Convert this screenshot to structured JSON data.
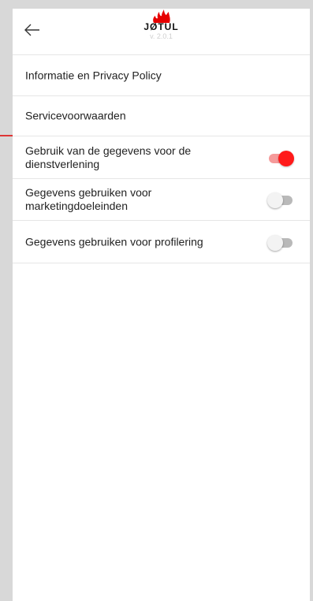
{
  "header": {
    "brand": "JØTUL",
    "version": "v. 2.0.1",
    "back_icon": "arrow-left-icon",
    "logo_icon": "flame-logo-icon"
  },
  "menu": {
    "items": [
      {
        "label": "Informatie en Privacy Policy"
      },
      {
        "label": "Servicevoorwaarden"
      }
    ]
  },
  "consents": [
    {
      "label": "Gebruik van de gegevens voor de dienstverlening",
      "enabled": true
    },
    {
      "label": "Gegevens gebruiken voor marketingdoeleinden",
      "enabled": false
    },
    {
      "label": "Gegevens gebruiken voor profilering",
      "enabled": false
    }
  ],
  "colors": {
    "accent": "#ff1a1a",
    "annotation_arrow": "#e00000"
  }
}
